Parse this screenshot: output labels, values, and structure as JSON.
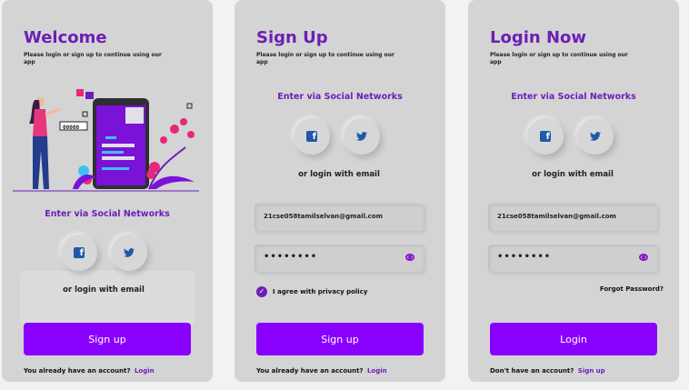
{
  "colors": {
    "accent": "#6b1fb8",
    "button": "#8a00ff",
    "panel": "#d4d4d4"
  },
  "welcome": {
    "title": "Welcome",
    "subtitle": "Please login or sign up to continue using our app",
    "screen_text": "00000",
    "enter_via": "Enter via Social Networks",
    "facebook_icon": "f",
    "or_login": "or login with email",
    "button": "Sign up",
    "account_text": "You already have an account?",
    "account_link": "Login"
  },
  "signup": {
    "title": "Sign Up",
    "subtitle": "Please login or sign up to continue using our app",
    "enter_via": "Enter via Social Networks",
    "facebook_icon": "f",
    "or_login": "or login with email",
    "email_value": "21cse058tamilselvan@gmail.com",
    "password_value": "••••••••",
    "agree": "I agree with privacy policy",
    "button": "Sign up",
    "account_text": "You already have an account?",
    "account_link": "Login"
  },
  "login": {
    "title": "Login Now",
    "subtitle": "Please login or sign up to continue using our app",
    "enter_via": "Enter via Social Networks",
    "facebook_icon": "f",
    "or_login": "or login with email",
    "email_value": "21cse058tamilselvan@gmail.com",
    "password_value": "••••••••",
    "forgot": "Forgot Password?",
    "button": "Login",
    "account_text": "Don't have an account?",
    "account_link": "Sign up"
  }
}
